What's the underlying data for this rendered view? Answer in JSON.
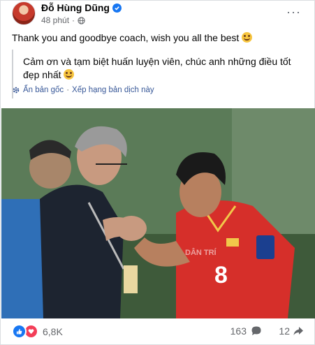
{
  "post": {
    "author": "Đỗ Hùng Dũng",
    "time": "48 phút",
    "separator": "·",
    "more": "···",
    "text": "Thank you and goodbye coach, wish you all the best",
    "translated_text": "Cảm ơn và tạm biệt huấn luyện viên, chúc anh những điều tốt đẹp nhất",
    "see_original": "Ẩn bản gốc",
    "rate_translation": "Xếp hạng bản dịch này",
    "link_separator": "·"
  },
  "photo": {
    "watermark": "DÂN TRÍ",
    "shirt_number": "8"
  },
  "stats": {
    "reactions": "6,8K",
    "comments": "163",
    "shares": "12"
  },
  "colors": {
    "brand_blue": "#1877f2",
    "love_red": "#f33e58",
    "jersey_red": "#d62f2a",
    "text_secondary": "#65676b"
  },
  "icons": {
    "verified": "verified-badge-icon",
    "globe": "globe-icon",
    "more": "more-icon",
    "gear": "gear-icon",
    "like": "like-icon",
    "love": "love-icon",
    "comment": "comment-icon",
    "share": "share-icon"
  }
}
